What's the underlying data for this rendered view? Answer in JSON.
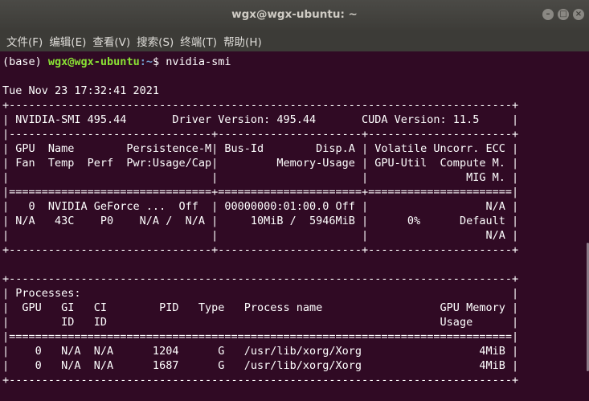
{
  "window": {
    "title": "wgx@wgx-ubuntu: ~",
    "controls": {
      "minimize": "–",
      "maximize": "□",
      "close": "×"
    }
  },
  "menu": {
    "items": [
      "文件(F)",
      "编辑(E)",
      "查看(V)",
      "搜索(S)",
      "终端(T)",
      "帮助(H)"
    ]
  },
  "terminal": {
    "prompt": {
      "env": "(base) ",
      "user_host": "wgx@wgx-ubuntu",
      "path": ":~",
      "symbol": "$ "
    },
    "command": "nvidia-smi",
    "output_lines": [
      "",
      "Tue Nov 23 17:32:41 2021",
      "+-----------------------------------------------------------------------------+",
      "| NVIDIA-SMI 495.44       Driver Version: 495.44       CUDA Version: 11.5     |",
      "|-------------------------------+----------------------+----------------------+",
      "| GPU  Name        Persistence-M| Bus-Id        Disp.A | Volatile Uncorr. ECC |",
      "| Fan  Temp  Perf  Pwr:Usage/Cap|         Memory-Usage | GPU-Util  Compute M. |",
      "|                               |                      |               MIG M. |",
      "|===============================+======================+======================|",
      "|   0  NVIDIA GeForce ...  Off  | 00000000:01:00.0 Off |                  N/A |",
      "| N/A   43C    P0    N/A /  N/A |     10MiB /  5946MiB |      0%      Default |",
      "|                               |                      |                  N/A |",
      "+-------------------------------+----------------------+----------------------+",
      "",
      "+-----------------------------------------------------------------------------+",
      "| Processes:                                                                  |",
      "|  GPU   GI   CI        PID   Type   Process name                  GPU Memory |",
      "|        ID   ID                                                   Usage      |",
      "|=============================================================================|",
      "|    0   N/A  N/A      1204      G   /usr/lib/xorg/Xorg                  4MiB |",
      "|    0   N/A  N/A      1687      G   /usr/lib/xorg/Xorg                  4MiB |",
      "+-----------------------------------------------------------------------------+"
    ]
  }
}
